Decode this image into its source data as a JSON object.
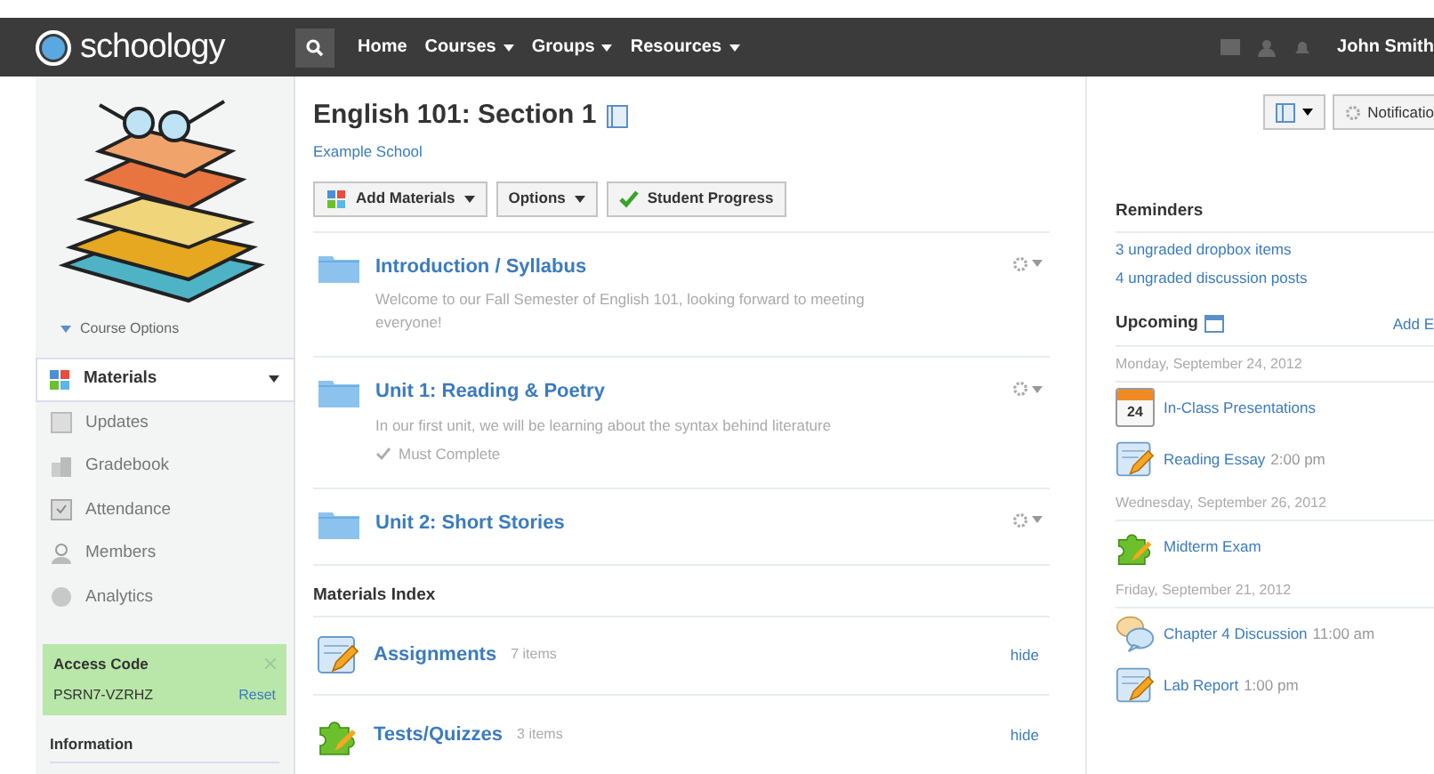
{
  "top_bar": {
    "logo": "schoology",
    "nav": [
      {
        "label": "Home",
        "dropdown": false
      },
      {
        "label": "Courses",
        "dropdown": true
      },
      {
        "label": "Groups",
        "dropdown": true
      },
      {
        "label": "Resources",
        "dropdown": true
      }
    ],
    "user": "John Smith"
  },
  "sidebar": {
    "course_options": "Course Options",
    "items": [
      {
        "label": "Materials",
        "selected": true
      },
      {
        "label": "Updates",
        "selected": false
      },
      {
        "label": "Gradebook",
        "selected": false
      },
      {
        "label": "Attendance",
        "selected": false
      },
      {
        "label": "Members",
        "selected": false
      },
      {
        "label": "Analytics",
        "selected": false
      }
    ],
    "access_code": {
      "title": "Access Code",
      "code": "PSRN7-VZRHZ",
      "reset": "Reset"
    },
    "information": "Information"
  },
  "course": {
    "title": "English 101: Section 1",
    "school": "Example School"
  },
  "toolbar": [
    {
      "label": "Add Materials",
      "kind": "add"
    },
    {
      "label": "Options",
      "kind": "menu"
    },
    {
      "label": "Student Progress",
      "kind": "progress"
    }
  ],
  "folders": [
    {
      "title": "Introduction / Syllabus",
      "description": "Welcome to our Fall Semester of English 101, looking forward to meeting everyone!",
      "must_complete": false
    },
    {
      "title": "Unit 1: Reading & Poetry",
      "description": "In our first unit, we will be learning about the syntax behind literature",
      "must_complete": true,
      "must_complete_label": "Must Complete"
    },
    {
      "title": "Unit 2: Short Stories",
      "must_complete": false
    }
  ],
  "materials_index": {
    "title": "Materials Index",
    "rows": [
      {
        "kind": "assignment",
        "title": "Assignments",
        "count": "7 items",
        "action": "hide"
      },
      {
        "kind": "quiz",
        "title": "Tests/Quizzes",
        "count": "3 items",
        "action": "hide"
      }
    ]
  },
  "header_buttons": {
    "notifications": "Notificatio"
  },
  "reminders": {
    "title": "Reminders",
    "links": [
      "3 ungraded dropbox items",
      "4 ungraded discussion posts"
    ]
  },
  "upcoming": {
    "title": "Upcoming",
    "add": "Add E",
    "days": [
      {
        "date": "Monday, September 24, 2012",
        "events": [
          {
            "kind": "event",
            "title": "In-Class Presentations",
            "calendar_day": "24"
          },
          {
            "kind": "assignment",
            "title": "Reading Essay",
            "time": "2:00 pm"
          }
        ]
      },
      {
        "date": "Wednesday, September 26, 2012",
        "events": [
          {
            "kind": "quiz",
            "title": "Midterm Exam"
          }
        ]
      },
      {
        "date": "Friday, September 21, 2012",
        "events": [
          {
            "kind": "discussion",
            "title": "Chapter 4 Discussion",
            "time": "11:00 am"
          },
          {
            "kind": "assignment",
            "title": "Lab Report",
            "time": "1:00 pm"
          }
        ]
      }
    ]
  }
}
